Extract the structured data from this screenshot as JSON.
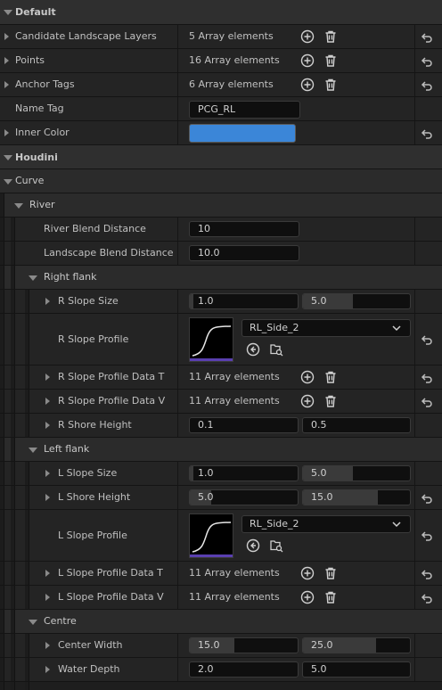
{
  "sections": {
    "default": "Default",
    "houdini": "Houdini",
    "curve": "Curve",
    "river": "River",
    "right_flank": "Right flank",
    "left_flank": "Left flank",
    "centre": "Centre"
  },
  "default_props": {
    "candidate_label": "Candidate Landscape Layers",
    "candidate_value": "5 Array elements",
    "points_label": "Points",
    "points_value": "16 Array elements",
    "anchor_label": "Anchor Tags",
    "anchor_value": "6 Array elements",
    "name_tag_label": "Name Tag",
    "name_tag_value": "PCG_RL",
    "inner_color_label": "Inner Color",
    "inner_color_hex": "#3b86d8"
  },
  "river": {
    "blend_label": "River Blend Distance",
    "blend_value": "10",
    "landscape_label": "Landscape Blend Distance",
    "landscape_value": "10.0"
  },
  "right_flank": {
    "slope_size_label": "R Slope Size",
    "slope_size_min": "1.0",
    "slope_size_max": "5.0",
    "slope_size_min_fill": 0.03,
    "slope_size_max_fill": 0.47,
    "slope_profile_label": "R Slope Profile",
    "slope_profile_asset": "RL_Side_2",
    "data_t_label": "R Slope Profile Data T",
    "data_t_value": "11 Array elements",
    "data_v_label": "R Slope Profile Data V",
    "data_v_value": "11 Array elements",
    "shore_label": "R Shore Height",
    "shore_min": "0.1",
    "shore_max": "0.5"
  },
  "left_flank": {
    "slope_size_label": "L Slope Size",
    "slope_size_min": "1.0",
    "slope_size_max": "5.0",
    "slope_size_min_fill": 0.03,
    "slope_size_max_fill": 0.47,
    "shore_label": "L Shore Height",
    "shore_min": "5.0",
    "shore_max": "15.0",
    "shore_min_fill": 0.2,
    "shore_max_fill": 0.7,
    "slope_profile_label": "L Slope Profile",
    "slope_profile_asset": "RL_Side_2",
    "data_t_label": "L Slope Profile Data T",
    "data_t_value": "11 Array elements",
    "data_v_label": "L Slope Profile Data V",
    "data_v_value": "11 Array elements"
  },
  "centre": {
    "width_label": "Center Width",
    "width_min": "15.0",
    "width_max": "25.0",
    "width_min_fill": 0.41,
    "width_max_fill": 0.68,
    "depth_label": "Water Depth",
    "depth_min": "2.0",
    "depth_max": "5.0"
  },
  "icons": {
    "add": "plus-circle-icon",
    "delete": "trash-icon",
    "reset": "reset-arrow-icon",
    "browse": "browse-arrow-icon",
    "find": "find-asset-icon"
  }
}
